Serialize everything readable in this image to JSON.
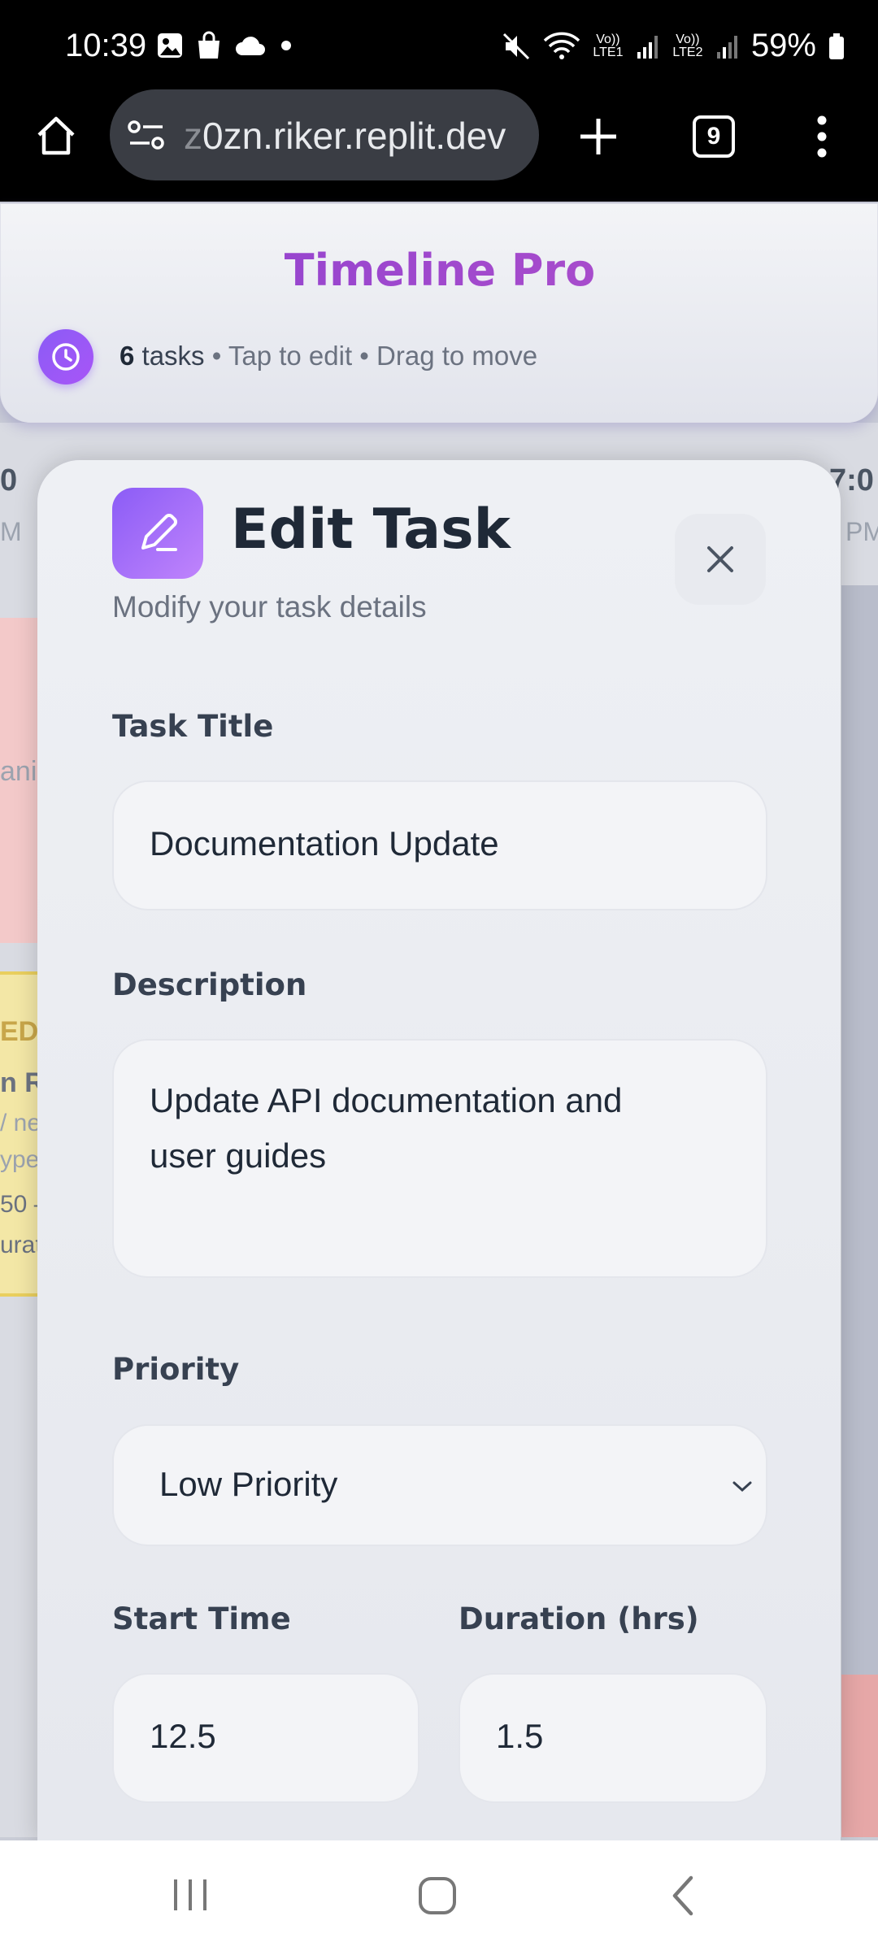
{
  "status_bar": {
    "time": "10:39",
    "battery": "59%",
    "net1": "Vo)) LTE1",
    "net2": "Vo)) LTE2"
  },
  "browser": {
    "url_prefix": "z",
    "url_main": "0zn.riker.replit.dev",
    "tab_count": "9"
  },
  "header": {
    "title": "Timeline Pro",
    "task_count": "6",
    "tasks_word": "tasks",
    "hint": "• Tap to edit • Drag to move"
  },
  "background": {
    "left_time": "0",
    "left_ampm": "M",
    "right_time": "7:0",
    "right_ampm": "PM",
    "frag_1": "anin",
    "frag_2": "EDI",
    "frag_3": "n Re",
    "frag_4": "/ ne",
    "frag_5": "ype",
    "frag_6": "50 –",
    "frag_7": "urat"
  },
  "modal": {
    "title": "Edit Task",
    "subtitle": "Modify your task details",
    "task_title_label": "Task Title",
    "task_title_value": "Documentation Update",
    "description_label": "Description",
    "description_line1": "Update API documentation and",
    "description_line2": "user guides",
    "priority_label": "Priority",
    "priority_value": "Low Priority",
    "start_time_label": "Start Time",
    "start_time_value": "12.5",
    "duration_label": "Duration (hrs)",
    "duration_value": "1.5"
  },
  "colors": {
    "accent": "#8b5cf6",
    "title_gradient_start": "#8a3fd1",
    "title_gradient_end": "#b552c9"
  }
}
